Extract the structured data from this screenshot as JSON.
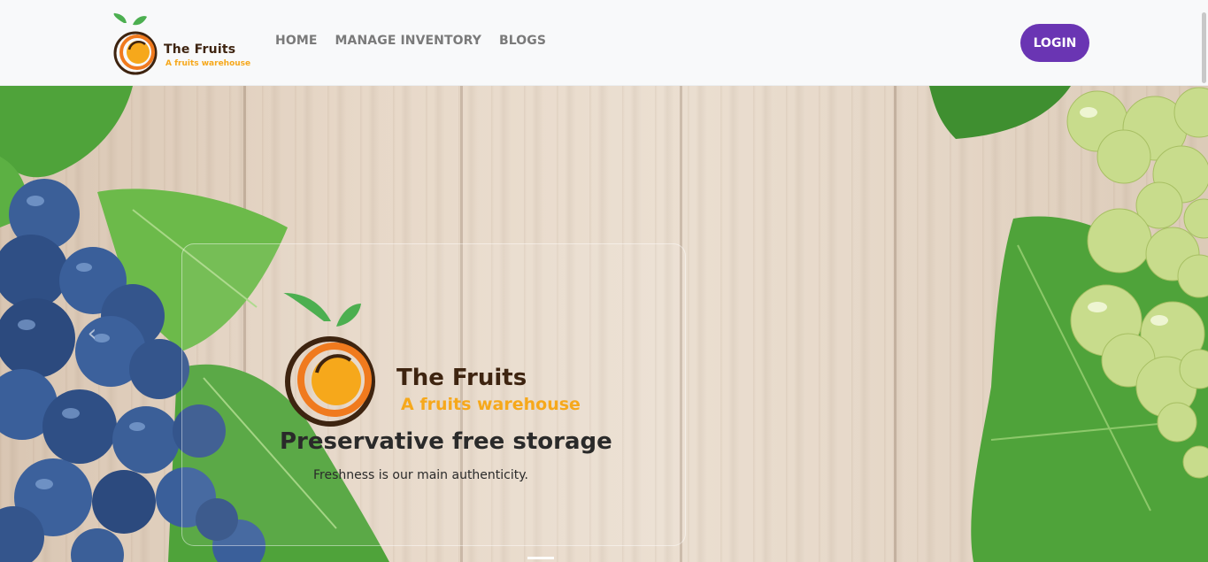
{
  "navbar": {
    "brand_name": "The Fruits",
    "brand_tagline": "A fruits warehouse",
    "links": [
      {
        "label": "HOME"
      },
      {
        "label": "MANAGE INVENTORY"
      },
      {
        "label": "BLOGS"
      }
    ],
    "login_label": "LOGIN"
  },
  "hero": {
    "logo_name": "The Fruits",
    "logo_tagline": "A fruits warehouse",
    "title": "Preservative free storage",
    "subtitle": "Freshness is our main authenticity.",
    "prev_arrow": "‹"
  },
  "colors": {
    "brand_dark": "#3e2410",
    "brand_orange": "#f6a81b",
    "accent_purple": "#6a35b3",
    "leaf_green": "#4caf50",
    "blueberry": "#3a5f9a",
    "grape_green": "#c8dc8c"
  }
}
